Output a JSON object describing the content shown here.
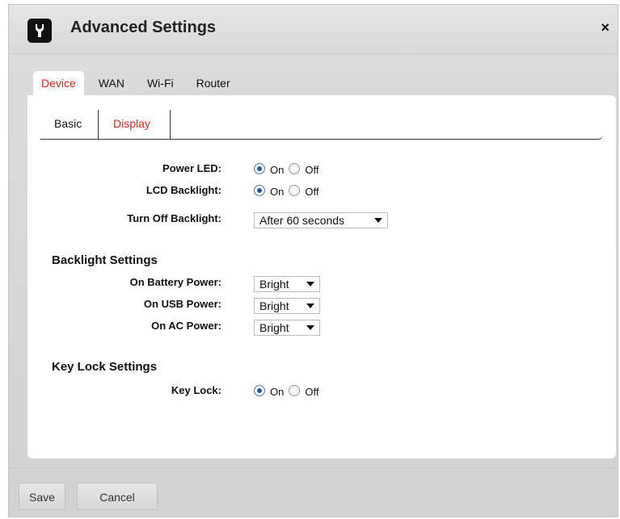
{
  "dialog": {
    "title": "Advanced Settings",
    "icon": "wrench-icon",
    "close_label": "×"
  },
  "tabs": [
    {
      "label": "Device",
      "active": true
    },
    {
      "label": "WAN",
      "active": false
    },
    {
      "label": "Wi-Fi",
      "active": false
    },
    {
      "label": "Router",
      "active": false
    }
  ],
  "subtabs": [
    {
      "label": "Basic",
      "active": false
    },
    {
      "label": "Display",
      "active": true
    }
  ],
  "display": {
    "power_led": {
      "label": "Power LED:",
      "on_label": "On",
      "off_label": "Off",
      "value": "On"
    },
    "lcd_backlight": {
      "label": "LCD Backlight:",
      "on_label": "On",
      "off_label": "Off",
      "value": "On"
    },
    "turn_off_backlight": {
      "label": "Turn Off Backlight:",
      "value": "After 60 seconds"
    }
  },
  "backlight_settings": {
    "heading": "Backlight Settings",
    "battery": {
      "label": "On Battery Power:",
      "value": "Bright"
    },
    "usb": {
      "label": "On USB Power:",
      "value": "Bright"
    },
    "ac": {
      "label": "On AC Power:",
      "value": "Bright"
    }
  },
  "key_lock_settings": {
    "heading": "Key Lock Settings",
    "key_lock": {
      "label": "Key Lock:",
      "on_label": "On",
      "off_label": "Off",
      "value": "On"
    }
  },
  "footer": {
    "save_label": "Save",
    "cancel_label": "Cancel"
  },
  "colors": {
    "accent": "#e2231a",
    "radio_selected": "#2357a8"
  }
}
